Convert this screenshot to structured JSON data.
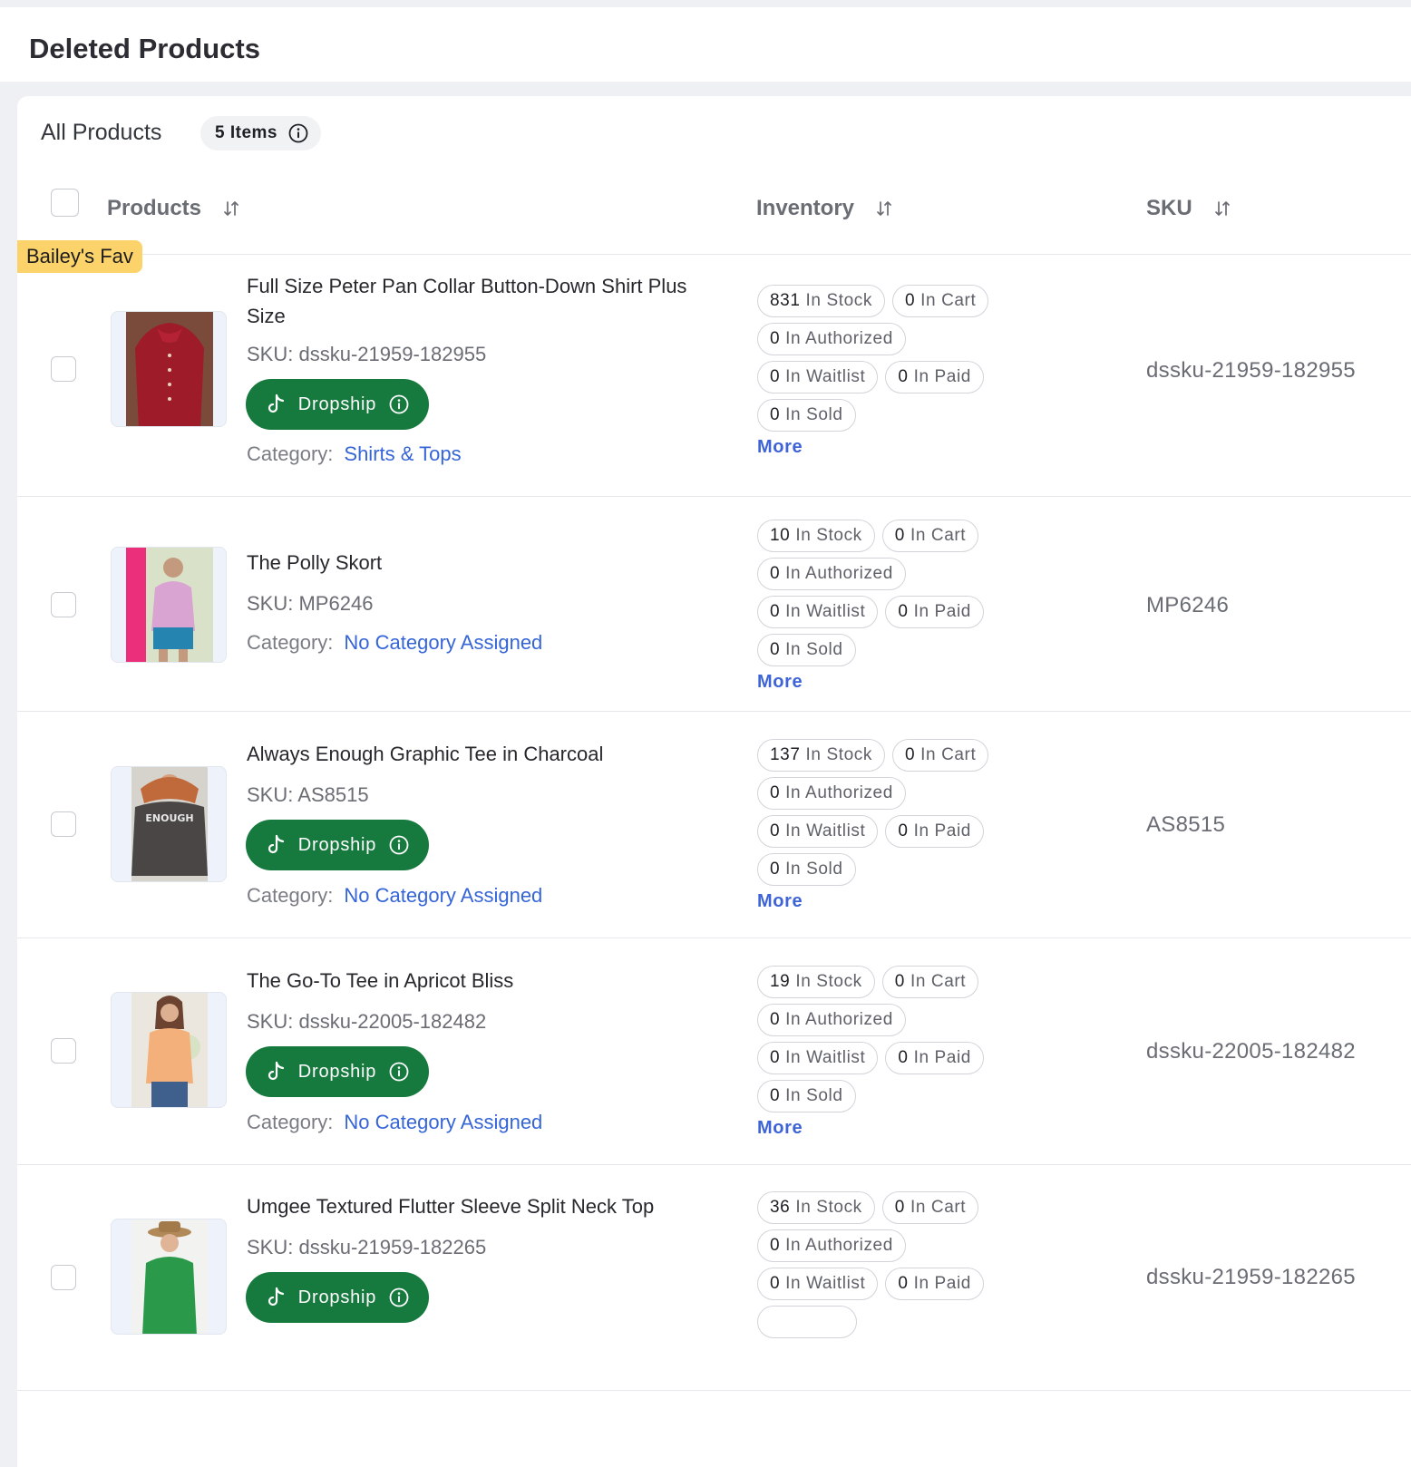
{
  "page": {
    "title": "Deleted Products"
  },
  "card": {
    "title": "All Products",
    "count_label": "5 Items"
  },
  "table": {
    "columns": {
      "products": "Products",
      "inventory": "Inventory",
      "sku": "SKU"
    }
  },
  "labels": {
    "sku_prefix": "SKU:",
    "category_prefix": "Category:",
    "dropship": "Dropship",
    "more": "More"
  },
  "colors": {
    "dropship_green": "#167a3e",
    "link_blue": "#3565d6",
    "fav_yellow": "#fcd36a"
  },
  "products": [
    {
      "badge": "Bailey's Fav",
      "name": "Full Size Peter Pan Collar Button-Down Shirt Plus Size",
      "sku_line": "dssku-21959-182955",
      "category": "Shirts & Tops",
      "sku": "dssku-21959-182955",
      "inventory": {
        "stock": "831",
        "cart": "0",
        "authorized": "0",
        "waitlist": "0",
        "paid": "0",
        "sold": "0"
      }
    },
    {
      "name": "The Polly Skort",
      "sku_line": "MP6246",
      "category": "No Category Assigned",
      "sku": "MP6246",
      "inventory": {
        "stock": "10",
        "cart": "0",
        "authorized": "0",
        "waitlist": "0",
        "paid": "0",
        "sold": "0"
      }
    },
    {
      "name": "Always Enough Graphic Tee in Charcoal",
      "sku_line": "AS8515",
      "category": "No Category Assigned",
      "sku": "AS8515",
      "inventory": {
        "stock": "137",
        "cart": "0",
        "authorized": "0",
        "waitlist": "0",
        "paid": "0",
        "sold": "0"
      }
    },
    {
      "name": "The Go-To Tee in Apricot Bliss",
      "sku_line": "dssku-22005-182482",
      "category": "No Category Assigned",
      "sku": "dssku-22005-182482",
      "inventory": {
        "stock": "19",
        "cart": "0",
        "authorized": "0",
        "waitlist": "0",
        "paid": "0",
        "sold": "0"
      }
    },
    {
      "name": "Umgee Textured Flutter Sleeve Split Neck Top",
      "sku_line": "dssku-21959-182265",
      "sku": "dssku-21959-182265",
      "inventory": {
        "stock": "36",
        "cart": "0",
        "authorized": "0",
        "waitlist": "0",
        "paid": "0"
      }
    }
  ],
  "inventory_labels": {
    "stock": "In Stock",
    "cart": "In Cart",
    "authorized": "In Authorized",
    "waitlist": "In Waitlist",
    "paid": "In Paid",
    "sold": "In Sold"
  }
}
